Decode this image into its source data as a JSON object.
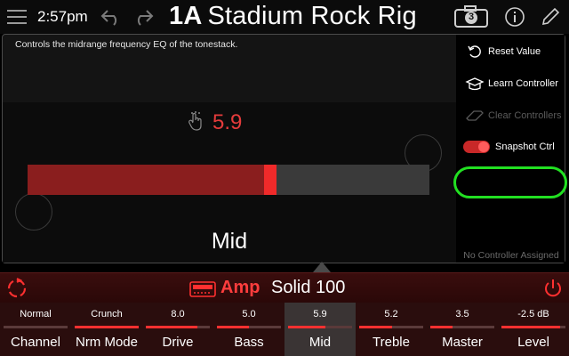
{
  "topbar": {
    "time": "2:57pm",
    "preset_number": "1A",
    "preset_name": "Stadium Rock Rig",
    "snapshot_number": "3",
    "icons": [
      "menu-icon",
      "undo-icon",
      "redo-icon",
      "snapshot-icon",
      "info-icon",
      "pencil-icon"
    ]
  },
  "panel": {
    "description": "Controls the midrange frequency EQ of the tonestack.",
    "value": "5.9",
    "value_fraction": 0.59,
    "param_name": "Mid",
    "menu": {
      "reset_value": "Reset Value",
      "learn_controller": "Learn Controller",
      "clear_controllers": "Clear Controllers",
      "snapshot_ctrl": "Snapshot Ctrl",
      "snapshot_ctrl_on": true,
      "no_controller": "No Controller Assigned"
    }
  },
  "model": {
    "category": "Amp",
    "name": "Solid 100"
  },
  "params": [
    {
      "label": "Channel",
      "value": "Normal",
      "fraction": 0.0
    },
    {
      "label": "Nrm Mode",
      "value": "Crunch",
      "fraction": 1.0
    },
    {
      "label": "Drive",
      "value": "8.0",
      "fraction": 0.8
    },
    {
      "label": "Bass",
      "value": "5.0",
      "fraction": 0.5
    },
    {
      "label": "Mid",
      "value": "5.9",
      "fraction": 0.59,
      "active": true
    },
    {
      "label": "Treble",
      "value": "5.2",
      "fraction": 0.52
    },
    {
      "label": "Master",
      "value": "3.5",
      "fraction": 0.35
    },
    {
      "label": "Level",
      "value": "-2.5 dB",
      "fraction": 0.92
    }
  ],
  "colors": {
    "accent": "#ff3030",
    "value_text": "#e43b3b",
    "highlight": "#22e022"
  }
}
